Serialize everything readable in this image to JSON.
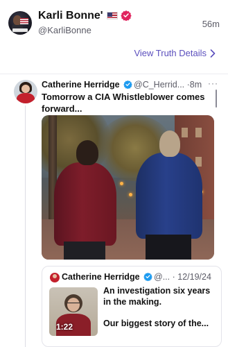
{
  "post": {
    "author_name": "Karli Bonne'",
    "author_handle": "@KarliBonne",
    "time": "56m",
    "view_details_label": "View Truth Details"
  },
  "quoted": {
    "author_name": "Catherine Herridge",
    "author_handle": "@C_Herrid...",
    "separator": "·",
    "time": "8m",
    "more": "···",
    "text": "Tomorrow a CIA Whistleblower comes forward..."
  },
  "nested": {
    "author_name": "Catherine Herridge",
    "author_handle": "@...",
    "separator": "·",
    "date": "12/19/24",
    "video_duration": "1:22",
    "text_line1": "An investigation six years in the making.",
    "text_line2": "Our biggest story of the..."
  },
  "colors": {
    "accent_link": "#5b4fbd",
    "verified_pink": "#e0245e",
    "verified_blue": "#1d9bf0"
  },
  "icons": {
    "verified_main": "verified-badge-icon",
    "verified_quote": "verified-check-icon",
    "details_arrow": "chevron-right-icon",
    "flag": "us-flag-icon"
  }
}
